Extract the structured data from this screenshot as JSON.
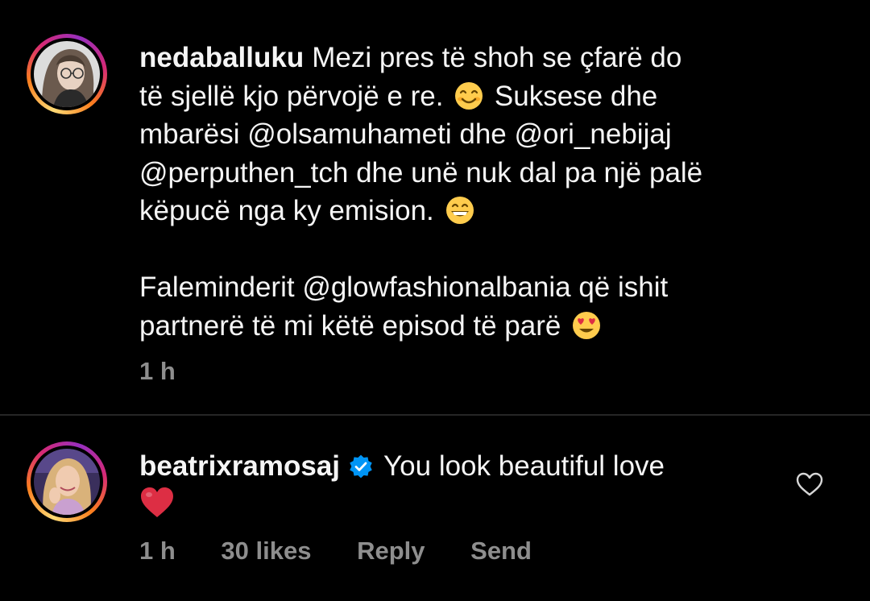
{
  "caption": {
    "username": "nedaballuku",
    "lines": [
      "Mezi pres të shoh se çfarë do",
      "të sjellë kjo përvojë e re.",
      "Suksese dhe",
      "mbarësi",
      "@olsamuhameti",
      "dhe",
      "@ori_nebijaj",
      "@perputhen_tch",
      "dhe unë nuk dal pa një palë",
      "këpucë nga ky emision."
    ],
    "thanks_prefix": "Faleminderit",
    "thanks_mention": "@glowfashionalbania",
    "thanks_suffix": "që ishit",
    "thanks_line2": "partnerë të mi këtë episod të parë",
    "time": "1 h",
    "emojis": [
      "smiling-face-emoji",
      "grinning-face-emoji",
      "heart-eyes-emoji"
    ]
  },
  "reply": {
    "username": "beatrixramosaj",
    "verified": true,
    "text": "You look beautiful love",
    "emoji": "red-heart-emoji",
    "time": "1 h",
    "likes": "30 likes",
    "reply_label": "Reply",
    "send_label": "Send"
  },
  "colors": {
    "background": "#000000",
    "text": "#f5f5f5",
    "meta": "#8e8e8e",
    "verified": "#0095f6",
    "divider": "#262626"
  }
}
